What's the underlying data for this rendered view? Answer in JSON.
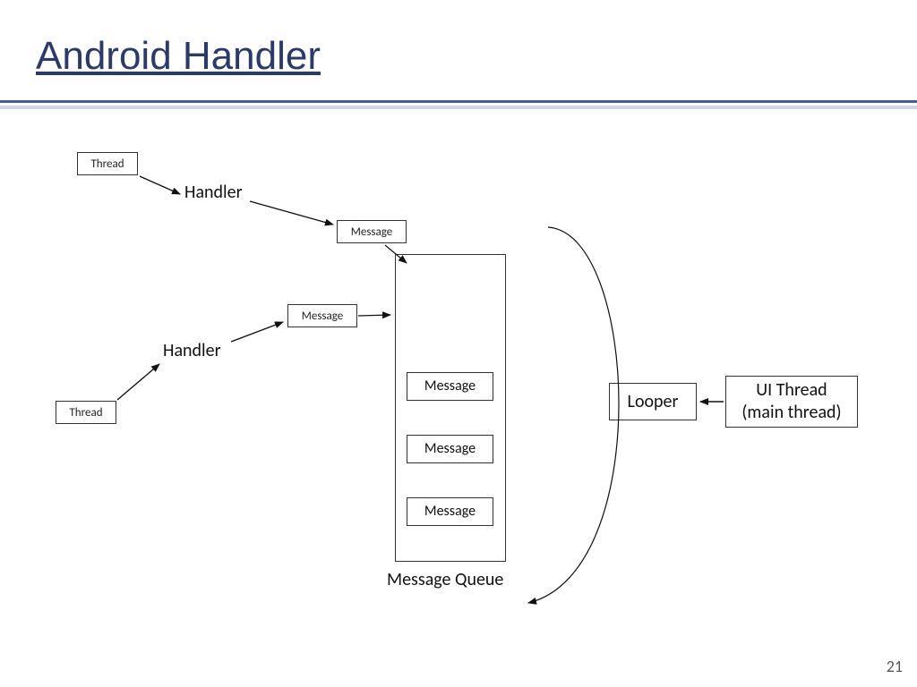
{
  "title": "Android Handler",
  "page_number": "21",
  "boxes": {
    "thread_top": "Thread",
    "thread_bottom": "Thread",
    "message_top": "Message",
    "message_mid": "Message",
    "queue_msg_1": "Message",
    "queue_msg_2": "Message",
    "queue_msg_3": "Message",
    "looper": "Looper",
    "ui_thread_line1": "UI Thread",
    "ui_thread_line2": "(main thread)"
  },
  "labels": {
    "handler_top": "Handler",
    "handler_bottom": "Handler",
    "queue_label": "Message Queue"
  }
}
